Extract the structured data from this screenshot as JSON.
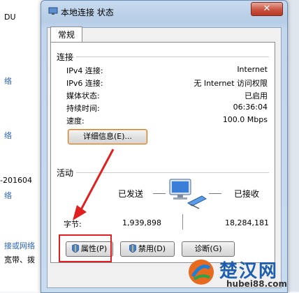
{
  "background": {
    "left_texts": [
      "DU",
      "络",
      "络",
      "-201604",
      "络",
      "接或网络",
      "宽带、拨"
    ]
  },
  "window": {
    "title": "本地连接 状态",
    "close_glyph": "✕",
    "tab": "常规",
    "connection_section": "连接",
    "rows": [
      {
        "label": "IPv4 连接:",
        "value": "Internet"
      },
      {
        "label": "IPv6 连接:",
        "value": "无 Internet 访问权限"
      },
      {
        "label": "媒体状态:",
        "value": "已启用"
      },
      {
        "label": "持续时间:",
        "value": "06:36:04"
      },
      {
        "label": "速度:",
        "value": "100.0 Mbps"
      }
    ],
    "details_button": "详细信息(E)...",
    "activity_section": "活动",
    "sent_label": "已发送",
    "received_label": "已接收",
    "bytes_label": "字节:",
    "bytes_sent": "1,939,898",
    "bytes_received": "18,284,181",
    "properties_button": "属性(P)",
    "disable_button": "禁用(D)",
    "diagnose_button": "诊断(G)"
  },
  "watermark": {
    "text": "楚汉网",
    "subtext": "hubei88.com"
  },
  "colors": {
    "annotation": "#e02020",
    "title_blue": "#b6cde6",
    "link_blue": "#2c63b5"
  }
}
